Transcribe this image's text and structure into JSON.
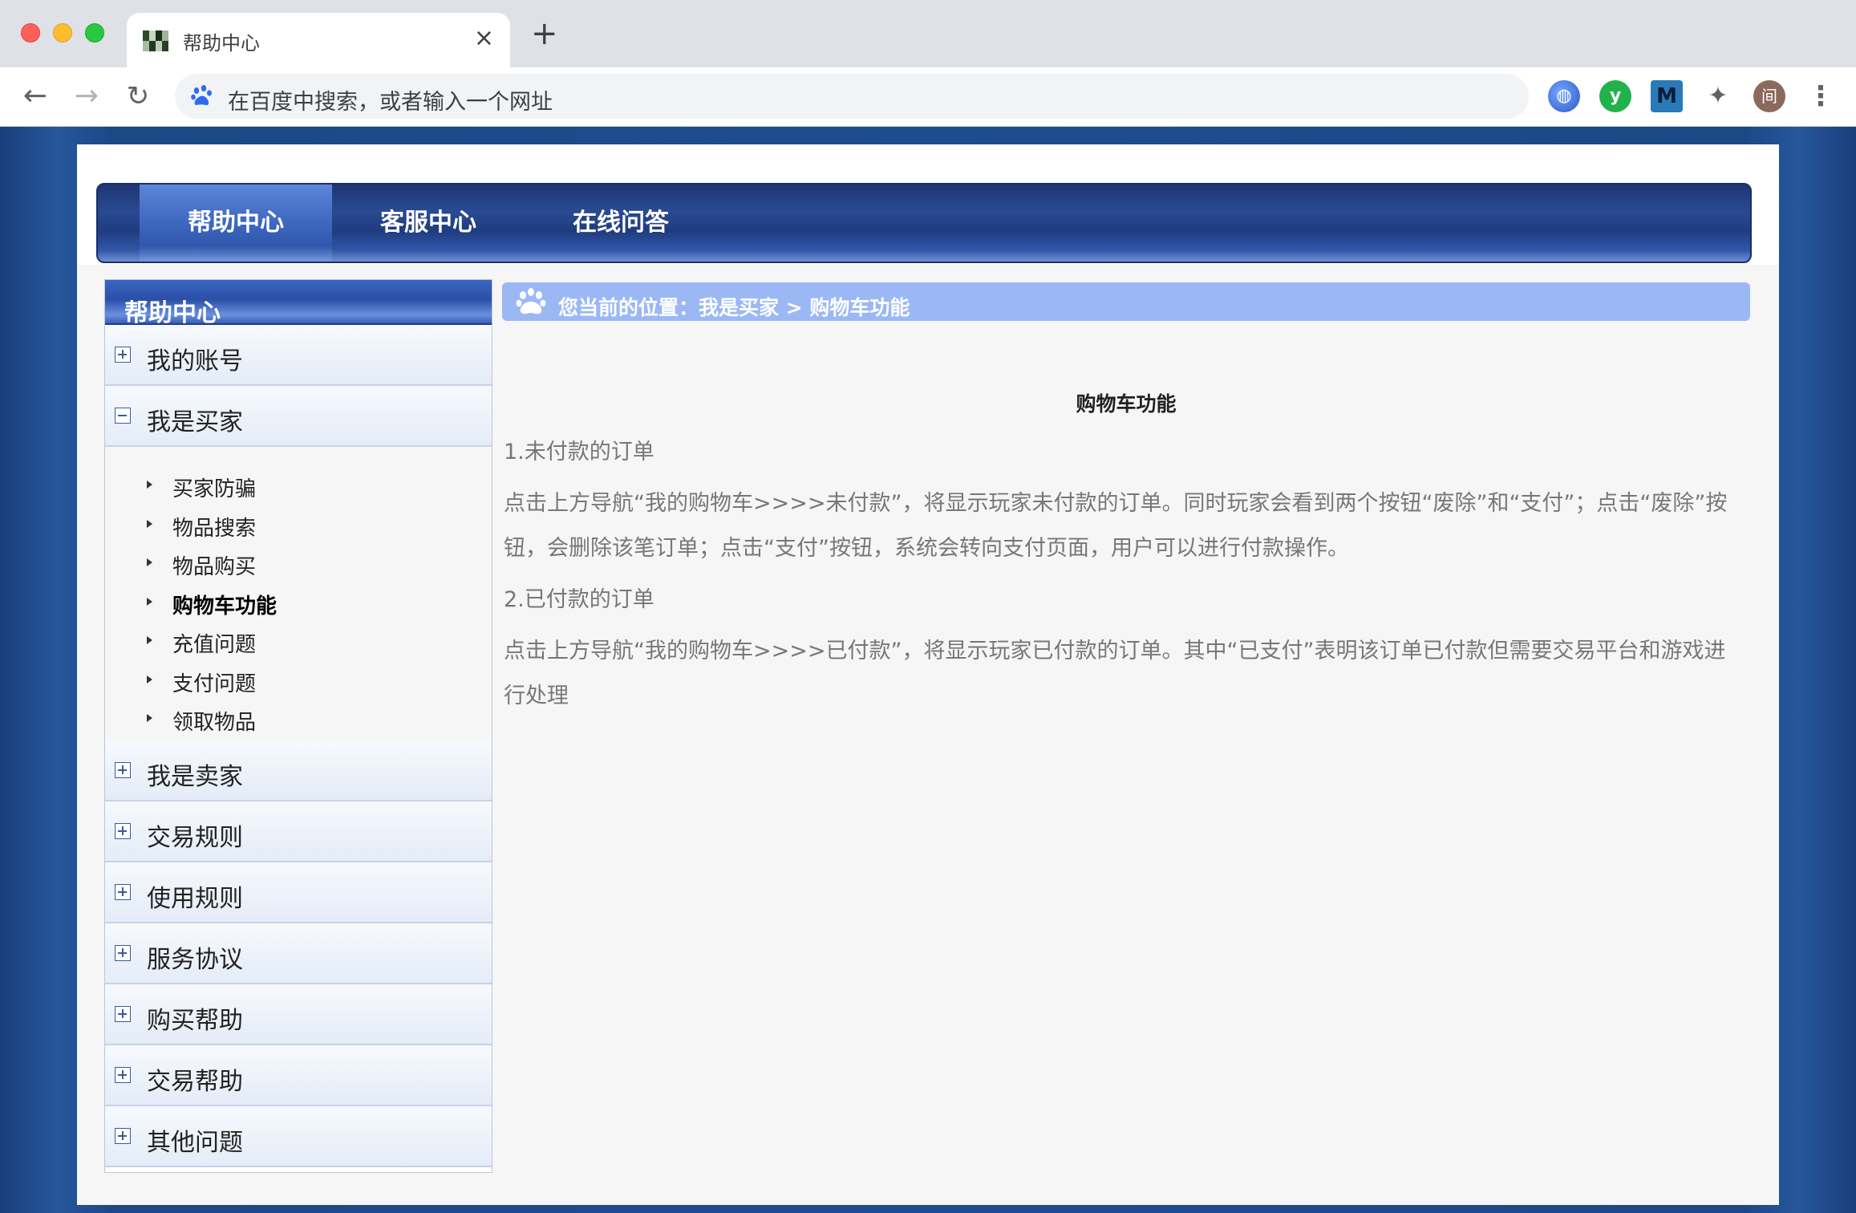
{
  "browser": {
    "tab_title": "帮助中心",
    "tab_close": "×",
    "new_tab": "+",
    "omnibox_placeholder": "在百度中搜索，或者输入一个网址",
    "avatar_label": "间",
    "ext_m_label": "M",
    "ext_y_label": "y"
  },
  "nav": {
    "items": [
      {
        "label": "帮助中心"
      },
      {
        "label": "客服中心"
      },
      {
        "label": "在线问答"
      }
    ]
  },
  "sidebar": {
    "title": "帮助中心",
    "sections": [
      {
        "label": "我的账号"
      },
      {
        "label": "我是买家"
      },
      {
        "label": "我是卖家"
      },
      {
        "label": "交易规则"
      },
      {
        "label": "使用规则"
      },
      {
        "label": "服务协议"
      },
      {
        "label": "购买帮助"
      },
      {
        "label": "交易帮助"
      },
      {
        "label": "其他问题"
      }
    ],
    "buyer_items": [
      {
        "label": "买家防骗"
      },
      {
        "label": "物品搜索"
      },
      {
        "label": "物品购买"
      },
      {
        "label": "购物车功能"
      },
      {
        "label": "充值问题"
      },
      {
        "label": "支付问题"
      },
      {
        "label": "领取物品"
      }
    ]
  },
  "breadcrumb": {
    "text": "您当前的位置：我是买家 > 购物车功能"
  },
  "article": {
    "title": "购物车功能",
    "h1": "1.未付款的订单",
    "p1": "点击上方导航“我的购物车>>>>未付款”，将显示玩家未付款的订单。同时玩家会看到两个按钮“废除”和“支付”；点击“废除”按钮，会删除该笔订单；点击“支付”按钮，系统会转向支付页面，用户可以进行付款操作。",
    "h2": "2.已付款的订单",
    "p2": "点击上方导航“我的购物车>>>>已付款”，将显示玩家已付款的订单。其中“已支付”表明该订单已付款但需要交易平台和游戏进行处理"
  },
  "colors": {
    "page_bg": "#1e4d8f",
    "nav_dark": "#203c80",
    "crumb_bg": "#9bb8f5",
    "article_text": "#777777"
  }
}
